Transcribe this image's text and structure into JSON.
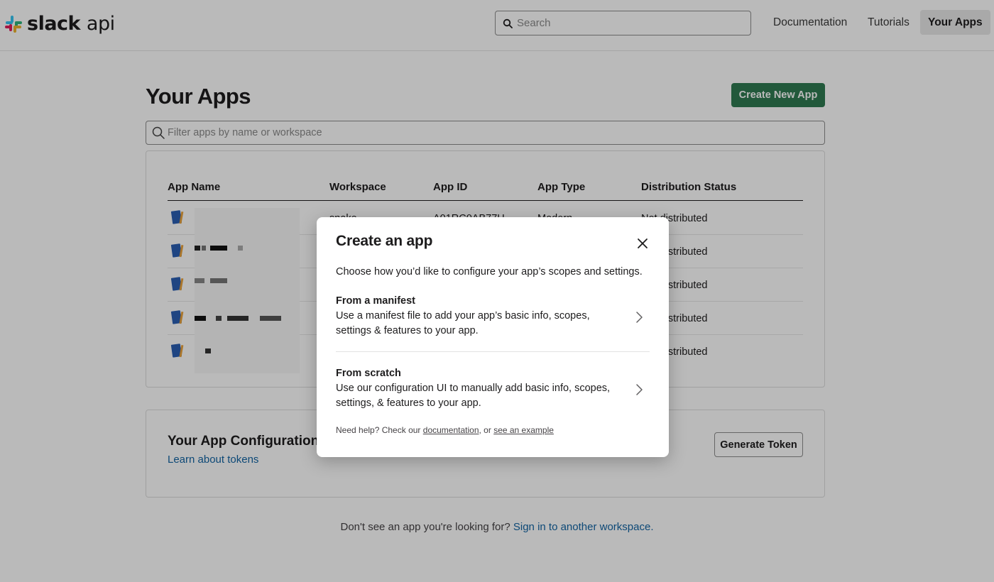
{
  "header": {
    "logo_bold": "slack",
    "logo_light": "api",
    "search_placeholder": "Search",
    "nav": [
      "Documentation",
      "Tutorials",
      "Your Apps"
    ]
  },
  "page": {
    "title": "Your Apps",
    "create_button": "Create New App",
    "filter_placeholder": "Filter apps by name or workspace"
  },
  "table": {
    "columns": [
      "App Name",
      "Workspace",
      "App ID",
      "App Type",
      "Distribution Status"
    ],
    "rows": [
      {
        "workspace": "snake",
        "app_id": "A01RC0AB77H",
        "app_type": "Modern",
        "status": "Not distributed"
      },
      {
        "status": "Not distributed"
      },
      {
        "status": "Not distributed"
      },
      {
        "status": "Not distributed"
      },
      {
        "status": "Not distributed"
      }
    ]
  },
  "tokens": {
    "title": "Your App Configuration Tokens",
    "link": "Learn about tokens",
    "button": "Generate Token"
  },
  "footer": {
    "text": "Don't see an app you're looking for?",
    "link": "Sign in to another workspace."
  },
  "modal": {
    "title": "Create an app",
    "subtitle": "Choose how you’d like to configure your app’s scopes and settings.",
    "options": [
      {
        "title": "From a manifest",
        "description": "Use a manifest file to add your app’s basic info, scopes, settings & features to your app."
      },
      {
        "title": "From scratch",
        "description": "Use our configuration UI to manually add basic info, scopes, settings, & features to your app."
      }
    ],
    "help_prefix": "Need help? Check our",
    "help_link1": "documentation",
    "help_mid": ", or",
    "help_link2": "see an example"
  },
  "colors": {
    "primary_button": "#2f7a52",
    "link": "#1264a3",
    "overlay": "rgba(0,0,0,0.27)"
  },
  "icons": [
    "slack-logo-icon",
    "search-icon",
    "app-book-icon",
    "close-icon",
    "chevron-right-icon"
  ]
}
